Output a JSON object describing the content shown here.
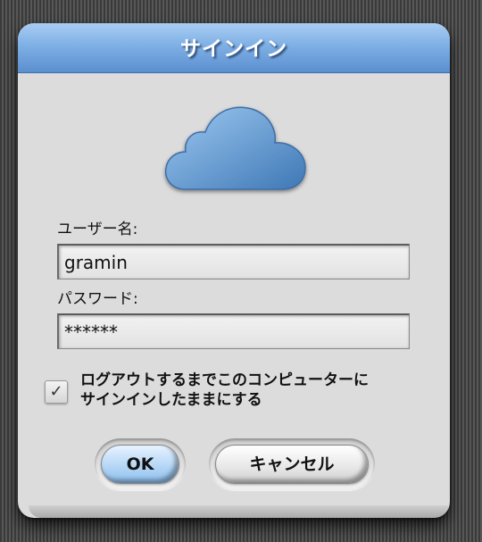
{
  "dialog": {
    "title": "サインイン",
    "icon": "cloud-icon",
    "username_label": "ユーザー名:",
    "username_value": "gramin",
    "password_label": "パスワード:",
    "password_value": "******",
    "remember_checked": true,
    "remember_label_line1": "ログアウトするまでこのコンピューターに",
    "remember_label_line2": "サインインしたままにする",
    "ok_label": "OK",
    "cancel_label": "キャンセル"
  },
  "colors": {
    "titlebar": "#7fb0e5",
    "cloud": "#6fa2d6",
    "dialog_bg": "#dcdcdc",
    "desktop_bg": "#4a4a4a"
  }
}
